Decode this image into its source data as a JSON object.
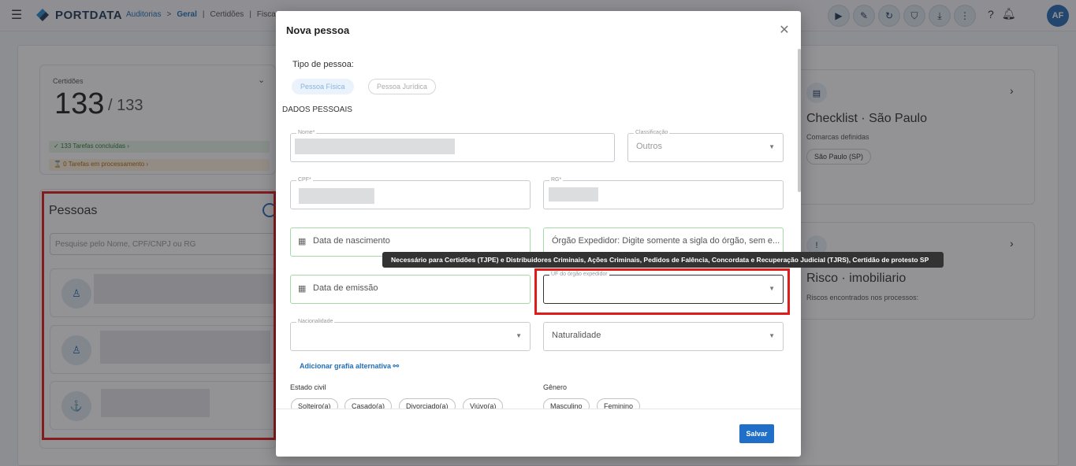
{
  "header": {
    "logo_text": "PORTDATA",
    "breadcrumb": [
      "Auditorias",
      ">",
      "Geral",
      "|",
      "Certidões",
      "|",
      "Fisca"
    ],
    "avatar_initials": "AF"
  },
  "certidoes": {
    "label": "Certidões",
    "count": "133",
    "total": "/ 133",
    "tarefas_concluidas": "✓ 133 Tarefas concluídas  ›",
    "tarefas_processamento": "⌛ 0 Tarefas em processamento  ›"
  },
  "pessoas": {
    "title": "Pessoas",
    "search_placeholder": "Pesquise pelo Nome, CPF/CNPJ ou RG"
  },
  "checklist": {
    "title": "Checklist · São Paulo",
    "subtitle": "Comarcas definidas",
    "badge": "São Paulo (SP)"
  },
  "risco": {
    "title": "Risco · imobiliario",
    "subtitle": "Riscos encontrados nos processos:"
  },
  "modal": {
    "title": "Nova pessoa",
    "tipo_label": "Tipo de pessoa:",
    "tipo_fisica": "Pessoa Física",
    "tipo_juridica": "Pessoa Jurídica",
    "section": "DADOS PESSOAIS",
    "nome_label": "Nome*",
    "classificacao_label": "Classificação",
    "classificacao_value": "Outros",
    "cpf_label": "CPF*",
    "rg_label": "RG*",
    "data_nascimento": "Data de nascimento",
    "orgao_expedidor": "Órgão Expedidor: Digite somente a sigla do órgão, sem e...",
    "data_emissao": "Data de emissão",
    "uf_label": "UF do órgão expedidor",
    "nacionalidade_label": "Nacionalidade",
    "naturalidade": "Naturalidade",
    "link_grafia": "Adicionar grafia alternativa",
    "estado_civil_label": "Estado civil",
    "estado_civil": [
      "Solteiro(a)",
      "Casado(a)",
      "Divorciado(a)",
      "Viúvo(a)"
    ],
    "genero_label": "Gênero",
    "genero": [
      "Masculino",
      "Feminino"
    ],
    "save_label": "Salvar"
  },
  "tooltip": "Necessário para Certidões (TJPE) e Distribuidores Criminais, Ações Criminais, Pedidos de Falência, Concordata e Recuperação Judicial (TJRS), Certidão de protesto SP"
}
